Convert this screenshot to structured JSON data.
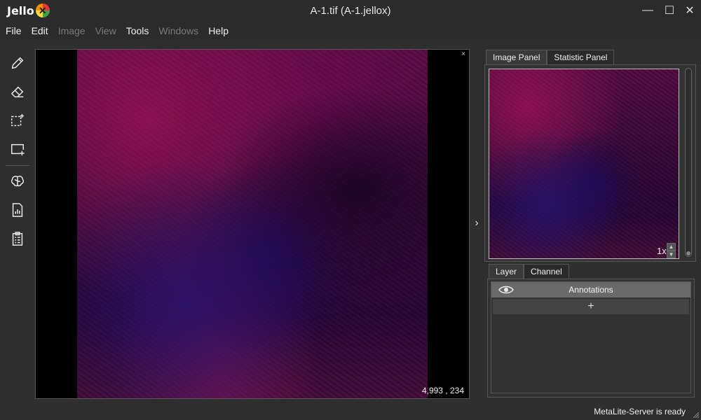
{
  "app": {
    "logo_text": "Jello",
    "window_title": "A-1.tif (A-1.jellox)"
  },
  "window_controls": {
    "minimize": "—",
    "maximize": "☐",
    "close": "✕"
  },
  "menu": [
    {
      "label": "File",
      "enabled": true
    },
    {
      "label": "Edit",
      "enabled": true
    },
    {
      "label": "Image",
      "enabled": false
    },
    {
      "label": "View",
      "enabled": false
    },
    {
      "label": "Tools",
      "enabled": true
    },
    {
      "label": "Windows",
      "enabled": false
    },
    {
      "label": "Help",
      "enabled": true
    }
  ],
  "toolbar": {
    "tools": [
      "pencil-icon",
      "eraser-icon",
      "selection-icon",
      "add-rect-icon",
      "brain-icon",
      "report-icon",
      "clipboard-icon"
    ]
  },
  "viewer": {
    "close_glyph": "×",
    "coordinates": "4,993 , 234"
  },
  "right_panel": {
    "top_tabs": [
      {
        "label": "Image Panel",
        "active": true
      },
      {
        "label": "Statistic Panel",
        "active": false
      }
    ],
    "zoom_level": "1x",
    "bottom_tabs": [
      {
        "label": "Layer",
        "active": true
      },
      {
        "label": "Channel",
        "active": false
      }
    ],
    "layers": [
      {
        "name": "Annotations",
        "visible": true
      }
    ],
    "add_layer_glyph": "+"
  },
  "status_bar": {
    "text": "MetaLite-Server is ready"
  },
  "colors": {
    "background": "#2e2e2e",
    "tissue_magenta": "#5a0f46",
    "tissue_blue": "#2a0a3a"
  }
}
